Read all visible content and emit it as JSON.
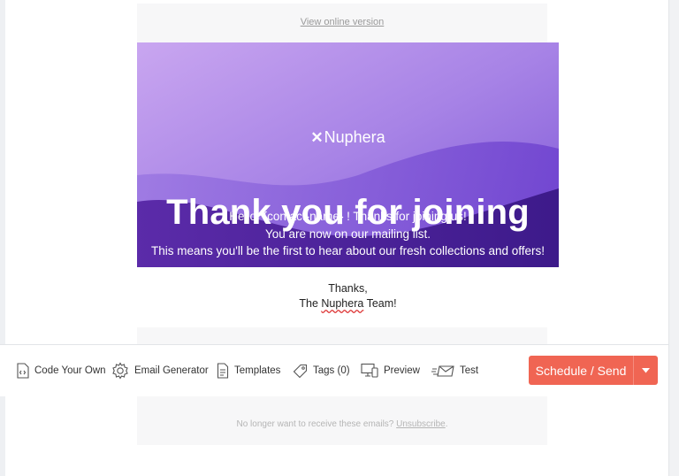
{
  "email": {
    "view_online": "View online version",
    "logo_text": "Nuphera",
    "headline": "Thank you for joining",
    "line1": "Hello, {contact-name} ! Thanks for joining us!",
    "line2": "You are now on our mailing list.",
    "line3": "This means you'll be the first to hear about our fresh collections and offers!",
    "thanks": "Thanks,",
    "signature_pre": "The ",
    "signature_brand": "Nuphera",
    "signature_post": " Team!",
    "unsub_text": "No longer want to receive these emails? ",
    "unsub_link": "Unsubscribe",
    "unsub_end": "."
  },
  "toolbar": {
    "code": "Code Your Own",
    "generator": "Email Generator",
    "templates": "Templates",
    "tags": "Tags (0)",
    "preview": "Preview",
    "test": "Test",
    "send": "Schedule / Send"
  },
  "colors": {
    "accent": "#f06553",
    "hero_light": "#c7a3ee",
    "hero_dark": "#5a2aa5"
  }
}
